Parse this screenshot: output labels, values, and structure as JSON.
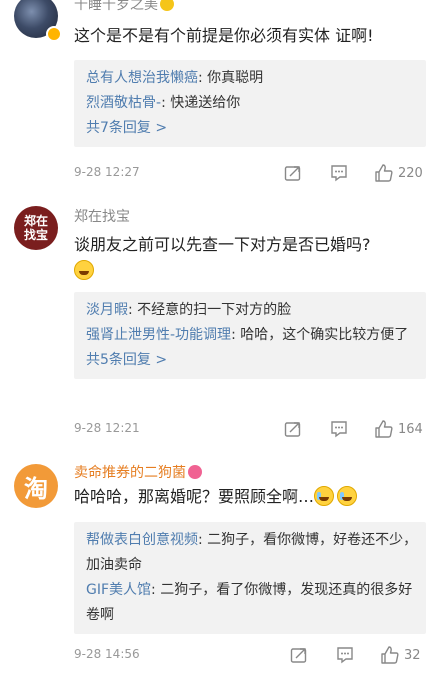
{
  "comments": [
    {
      "username": "千睡千岁之美",
      "content": "这个是不是有个前提是你必须有实体 证啊!",
      "replies": [
        {
          "user": "总有人想治我懒癌",
          "text": ": 你真聪明"
        },
        {
          "user": "烈酒敬枯骨-",
          "text": ": 快递送给你"
        }
      ],
      "more": "共7条回复 >",
      "date": "9-28 12:27",
      "likes": "220"
    },
    {
      "username": "郑在找宝",
      "avatar_text": [
        "郑在",
        "找宝"
      ],
      "content": "谈朋友之前可以先查一下对方是否已婚吗?",
      "replies": [
        {
          "user": "淡月暇",
          "text": ": 不经意的扫一下对方的脸"
        },
        {
          "user": "强肾止泄男性-功能调理",
          "text": ": 哈哈，这个确实比较方便了"
        }
      ],
      "more": "共5条回复 >",
      "date": "9-28 12:21",
      "likes": "164"
    },
    {
      "username": "卖命推券的二狗菌",
      "avatar_text": "淘",
      "content": "哈哈哈，那离婚呢？要照顾全啊…",
      "replies": [
        {
          "user": "帮做表白创意视频",
          "text": ": 二狗子，看你微博，好卷还不少，加油卖命"
        },
        {
          "user": "GIF美人馆",
          "text": ": 二狗子，看了你微博，发现还真的很多好卷啊"
        }
      ],
      "date": "9-28 14:56",
      "likes": "32"
    }
  ],
  "icons": [
    "share-icon",
    "comment-icon",
    "like-icon"
  ]
}
